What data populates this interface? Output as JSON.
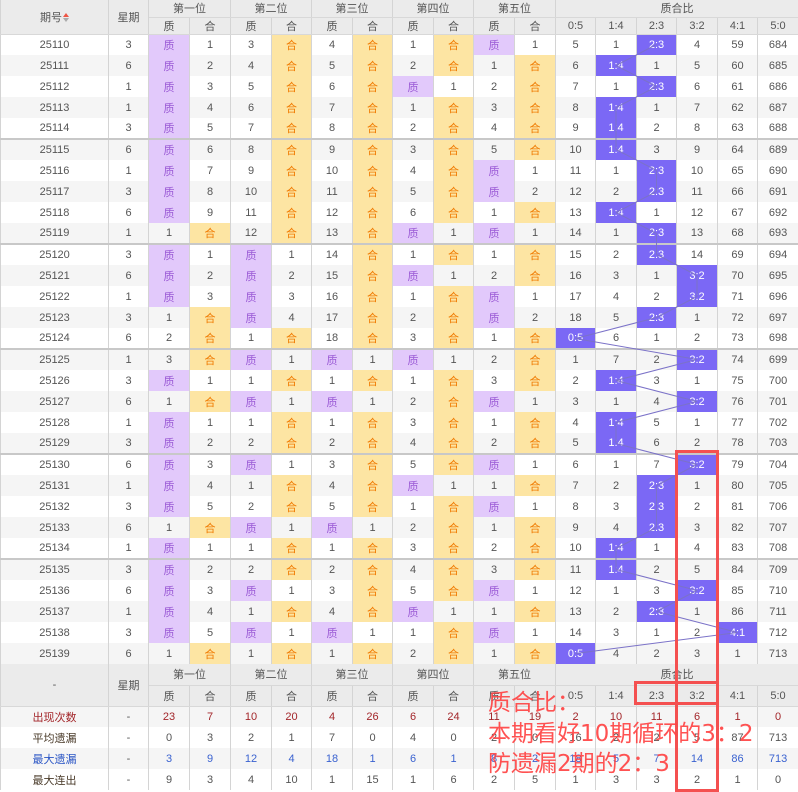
{
  "header": {
    "period": "期号",
    "week": "星期",
    "positions": [
      "第一位",
      "第二位",
      "第三位",
      "第四位",
      "第五位"
    ],
    "zhi": "质",
    "he": "合",
    "ratio_title": "质合比",
    "ratios": [
      "0:5",
      "1:4",
      "2:3",
      "3:2",
      "4:1",
      "5:0"
    ]
  },
  "rows": [
    {
      "period": "25110",
      "week": "3",
      "pos": [
        [
          "质",
          "1"
        ],
        [
          "3",
          "合"
        ],
        [
          "4",
          "合"
        ],
        [
          "1",
          "合"
        ],
        [
          "质",
          "1"
        ]
      ],
      "ratio": [
        "5",
        "1",
        "2:3",
        "4",
        "59",
        "684"
      ]
    },
    {
      "period": "25111",
      "week": "6",
      "pos": [
        [
          "质",
          "2"
        ],
        [
          "4",
          "合"
        ],
        [
          "5",
          "合"
        ],
        [
          "2",
          "合"
        ],
        [
          "1",
          "合"
        ]
      ],
      "ratio": [
        "6",
        "1:4",
        "1",
        "5",
        "60",
        "685"
      ]
    },
    {
      "period": "25112",
      "week": "1",
      "pos": [
        [
          "质",
          "3"
        ],
        [
          "5",
          "合"
        ],
        [
          "6",
          "合"
        ],
        [
          "质",
          "1"
        ],
        [
          "2",
          "合"
        ]
      ],
      "ratio": [
        "7",
        "1",
        "2:3",
        "6",
        "61",
        "686"
      ]
    },
    {
      "period": "25113",
      "week": "1",
      "pos": [
        [
          "质",
          "4"
        ],
        [
          "6",
          "合"
        ],
        [
          "7",
          "合"
        ],
        [
          "1",
          "合"
        ],
        [
          "3",
          "合"
        ]
      ],
      "ratio": [
        "8",
        "1:4",
        "1",
        "7",
        "62",
        "687"
      ]
    },
    {
      "period": "25114",
      "week": "3",
      "pos": [
        [
          "质",
          "5"
        ],
        [
          "7",
          "合"
        ],
        [
          "8",
          "合"
        ],
        [
          "2",
          "合"
        ],
        [
          "4",
          "合"
        ]
      ],
      "ratio": [
        "9",
        "1:4",
        "2",
        "8",
        "63",
        "688"
      ]
    },
    {
      "period": "25115",
      "week": "6",
      "pos": [
        [
          "质",
          "6"
        ],
        [
          "8",
          "合"
        ],
        [
          "9",
          "合"
        ],
        [
          "3",
          "合"
        ],
        [
          "5",
          "合"
        ]
      ],
      "ratio": [
        "10",
        "1:4",
        "3",
        "9",
        "64",
        "689"
      ]
    },
    {
      "period": "25116",
      "week": "1",
      "pos": [
        [
          "质",
          "7"
        ],
        [
          "9",
          "合"
        ],
        [
          "10",
          "合"
        ],
        [
          "4",
          "合"
        ],
        [
          "质",
          "1"
        ]
      ],
      "ratio": [
        "11",
        "1",
        "2:3",
        "10",
        "65",
        "690"
      ]
    },
    {
      "period": "25117",
      "week": "3",
      "pos": [
        [
          "质",
          "8"
        ],
        [
          "10",
          "合"
        ],
        [
          "11",
          "合"
        ],
        [
          "5",
          "合"
        ],
        [
          "质",
          "2"
        ]
      ],
      "ratio": [
        "12",
        "2",
        "2:3",
        "11",
        "66",
        "691"
      ]
    },
    {
      "period": "25118",
      "week": "6",
      "pos": [
        [
          "质",
          "9"
        ],
        [
          "11",
          "合"
        ],
        [
          "12",
          "合"
        ],
        [
          "6",
          "合"
        ],
        [
          "1",
          "合"
        ]
      ],
      "ratio": [
        "13",
        "1:4",
        "1",
        "12",
        "67",
        "692"
      ]
    },
    {
      "period": "25119",
      "week": "1",
      "pos": [
        [
          "1",
          "合"
        ],
        [
          "12",
          "合"
        ],
        [
          "13",
          "合"
        ],
        [
          "质",
          "1"
        ],
        [
          "质",
          "1"
        ]
      ],
      "ratio": [
        "14",
        "1",
        "2:3",
        "13",
        "68",
        "693"
      ]
    },
    {
      "period": "25120",
      "week": "3",
      "pos": [
        [
          "质",
          "1"
        ],
        [
          "质",
          "1"
        ],
        [
          "14",
          "合"
        ],
        [
          "1",
          "合"
        ],
        [
          "1",
          "合"
        ]
      ],
      "ratio": [
        "15",
        "2",
        "2:3",
        "14",
        "69",
        "694"
      ]
    },
    {
      "period": "25121",
      "week": "6",
      "pos": [
        [
          "质",
          "2"
        ],
        [
          "质",
          "2"
        ],
        [
          "15",
          "合"
        ],
        [
          "质",
          "1"
        ],
        [
          "2",
          "合"
        ]
      ],
      "ratio": [
        "16",
        "3",
        "1",
        "3:2",
        "70",
        "695"
      ]
    },
    {
      "period": "25122",
      "week": "1",
      "pos": [
        [
          "质",
          "3"
        ],
        [
          "质",
          "3"
        ],
        [
          "16",
          "合"
        ],
        [
          "1",
          "合"
        ],
        [
          "质",
          "1"
        ]
      ],
      "ratio": [
        "17",
        "4",
        "2",
        "3:2",
        "71",
        "696"
      ]
    },
    {
      "period": "25123",
      "week": "3",
      "pos": [
        [
          "1",
          "合"
        ],
        [
          "质",
          "4"
        ],
        [
          "17",
          "合"
        ],
        [
          "2",
          "合"
        ],
        [
          "质",
          "2"
        ]
      ],
      "ratio": [
        "18",
        "5",
        "2:3",
        "1",
        "72",
        "697"
      ]
    },
    {
      "period": "25124",
      "week": "6",
      "pos": [
        [
          "2",
          "合"
        ],
        [
          "1",
          "合"
        ],
        [
          "18",
          "合"
        ],
        [
          "3",
          "合"
        ],
        [
          "1",
          "合"
        ]
      ],
      "ratio": [
        "0:5",
        "6",
        "1",
        "2",
        "73",
        "698"
      ]
    },
    {
      "period": "25125",
      "week": "1",
      "pos": [
        [
          "3",
          "合"
        ],
        [
          "质",
          "1"
        ],
        [
          "质",
          "1"
        ],
        [
          "质",
          "1"
        ],
        [
          "2",
          "合"
        ]
      ],
      "ratio": [
        "1",
        "7",
        "2",
        "3:2",
        "74",
        "699"
      ]
    },
    {
      "period": "25126",
      "week": "3",
      "pos": [
        [
          "质",
          "1"
        ],
        [
          "1",
          "合"
        ],
        [
          "1",
          "合"
        ],
        [
          "1",
          "合"
        ],
        [
          "3",
          "合"
        ]
      ],
      "ratio": [
        "2",
        "1:4",
        "3",
        "1",
        "75",
        "700"
      ]
    },
    {
      "period": "25127",
      "week": "6",
      "pos": [
        [
          "1",
          "合"
        ],
        [
          "质",
          "1"
        ],
        [
          "质",
          "1"
        ],
        [
          "2",
          "合"
        ],
        [
          "质",
          "1"
        ]
      ],
      "ratio": [
        "3",
        "1",
        "4",
        "3:2",
        "76",
        "701"
      ]
    },
    {
      "period": "25128",
      "week": "1",
      "pos": [
        [
          "质",
          "1"
        ],
        [
          "1",
          "合"
        ],
        [
          "1",
          "合"
        ],
        [
          "3",
          "合"
        ],
        [
          "1",
          "合"
        ]
      ],
      "ratio": [
        "4",
        "1:4",
        "5",
        "1",
        "77",
        "702"
      ]
    },
    {
      "period": "25129",
      "week": "3",
      "pos": [
        [
          "质",
          "2"
        ],
        [
          "2",
          "合"
        ],
        [
          "2",
          "合"
        ],
        [
          "4",
          "合"
        ],
        [
          "2",
          "合"
        ]
      ],
      "ratio": [
        "5",
        "1:4",
        "6",
        "2",
        "78",
        "703"
      ]
    },
    {
      "period": "25130",
      "week": "6",
      "pos": [
        [
          "质",
          "3"
        ],
        [
          "质",
          "1"
        ],
        [
          "3",
          "合"
        ],
        [
          "5",
          "合"
        ],
        [
          "质",
          "1"
        ]
      ],
      "ratio": [
        "6",
        "1",
        "7",
        "3:2",
        "79",
        "704"
      ]
    },
    {
      "period": "25131",
      "week": "1",
      "pos": [
        [
          "质",
          "4"
        ],
        [
          "1",
          "合"
        ],
        [
          "4",
          "合"
        ],
        [
          "质",
          "1"
        ],
        [
          "1",
          "合"
        ]
      ],
      "ratio": [
        "7",
        "2",
        "2:3",
        "1",
        "80",
        "705"
      ]
    },
    {
      "period": "25132",
      "week": "3",
      "pos": [
        [
          "质",
          "5"
        ],
        [
          "2",
          "合"
        ],
        [
          "5",
          "合"
        ],
        [
          "1",
          "合"
        ],
        [
          "质",
          "1"
        ]
      ],
      "ratio": [
        "8",
        "3",
        "2:3",
        "2",
        "81",
        "706"
      ]
    },
    {
      "period": "25133",
      "week": "6",
      "pos": [
        [
          "1",
          "合"
        ],
        [
          "质",
          "1"
        ],
        [
          "质",
          "1"
        ],
        [
          "2",
          "合"
        ],
        [
          "1",
          "合"
        ]
      ],
      "ratio": [
        "9",
        "4",
        "2:3",
        "3",
        "82",
        "707"
      ]
    },
    {
      "period": "25134",
      "week": "1",
      "pos": [
        [
          "质",
          "1"
        ],
        [
          "1",
          "合"
        ],
        [
          "1",
          "合"
        ],
        [
          "3",
          "合"
        ],
        [
          "2",
          "合"
        ]
      ],
      "ratio": [
        "10",
        "1:4",
        "1",
        "4",
        "83",
        "708"
      ]
    },
    {
      "period": "25135",
      "week": "3",
      "pos": [
        [
          "质",
          "2"
        ],
        [
          "2",
          "合"
        ],
        [
          "2",
          "合"
        ],
        [
          "4",
          "合"
        ],
        [
          "3",
          "合"
        ]
      ],
      "ratio": [
        "11",
        "1:4",
        "2",
        "5",
        "84",
        "709"
      ]
    },
    {
      "period": "25136",
      "week": "6",
      "pos": [
        [
          "质",
          "3"
        ],
        [
          "质",
          "1"
        ],
        [
          "3",
          "合"
        ],
        [
          "5",
          "合"
        ],
        [
          "质",
          "1"
        ]
      ],
      "ratio": [
        "12",
        "1",
        "3",
        "3:2",
        "85",
        "710"
      ]
    },
    {
      "period": "25137",
      "week": "1",
      "pos": [
        [
          "质",
          "4"
        ],
        [
          "1",
          "合"
        ],
        [
          "4",
          "合"
        ],
        [
          "质",
          "1"
        ],
        [
          "1",
          "合"
        ]
      ],
      "ratio": [
        "13",
        "2",
        "2:3",
        "1",
        "86",
        "711"
      ]
    },
    {
      "period": "25138",
      "week": "3",
      "pos": [
        [
          "质",
          "5"
        ],
        [
          "质",
          "1"
        ],
        [
          "质",
          "1"
        ],
        [
          "1",
          "合"
        ],
        [
          "质",
          "1"
        ]
      ],
      "ratio": [
        "14",
        "3",
        "1",
        "2",
        "4:1",
        "712"
      ]
    },
    {
      "period": "25139",
      "week": "6",
      "pos": [
        [
          "1",
          "合"
        ],
        [
          "1",
          "合"
        ],
        [
          "1",
          "合"
        ],
        [
          "2",
          "合"
        ],
        [
          "1",
          "合"
        ]
      ],
      "ratio": [
        "0:5",
        "4",
        "2",
        "3",
        "1",
        "713"
      ]
    }
  ],
  "footer": {
    "first_cell": "-",
    "stats": [
      {
        "label": "出现次数",
        "week": "-",
        "values": [
          "23",
          "7",
          "10",
          "20",
          "4",
          "26",
          "6",
          "24",
          "11",
          "19",
          "2",
          "10",
          "11",
          "6",
          "1",
          "0"
        ],
        "style": "red"
      },
      {
        "label": "平均遗漏",
        "week": "-",
        "values": [
          "0",
          "3",
          "2",
          "1",
          "7",
          "0",
          "4",
          "0",
          "2",
          "0",
          "16",
          "2",
          "2",
          "5",
          "87",
          "713"
        ],
        "style": "dark"
      },
      {
        "label": "最大遗漏",
        "week": "-",
        "values": [
          "3",
          "9",
          "12",
          "4",
          "18",
          "1",
          "6",
          "1",
          "8",
          "2",
          "18",
          "5",
          "7",
          "14",
          "86",
          "713"
        ],
        "style": "blue"
      },
      {
        "label": "最大连出",
        "week": "-",
        "values": [
          "9",
          "3",
          "4",
          "10",
          "1",
          "15",
          "1",
          "6",
          "2",
          "5",
          "1",
          "3",
          "3",
          "2",
          "1",
          "0"
        ],
        "style": "dark"
      }
    ]
  },
  "annotation": {
    "line1": "质合比：",
    "line2": "本期看好10期循环的3：2",
    "line3": "防遗漏2期的2：3"
  },
  "colors": {
    "zhi_bg": "#e2c9fb",
    "he_bg": "#fde5a3",
    "ratio_bg": "#7b68f5",
    "annotation": "#ff4444"
  }
}
